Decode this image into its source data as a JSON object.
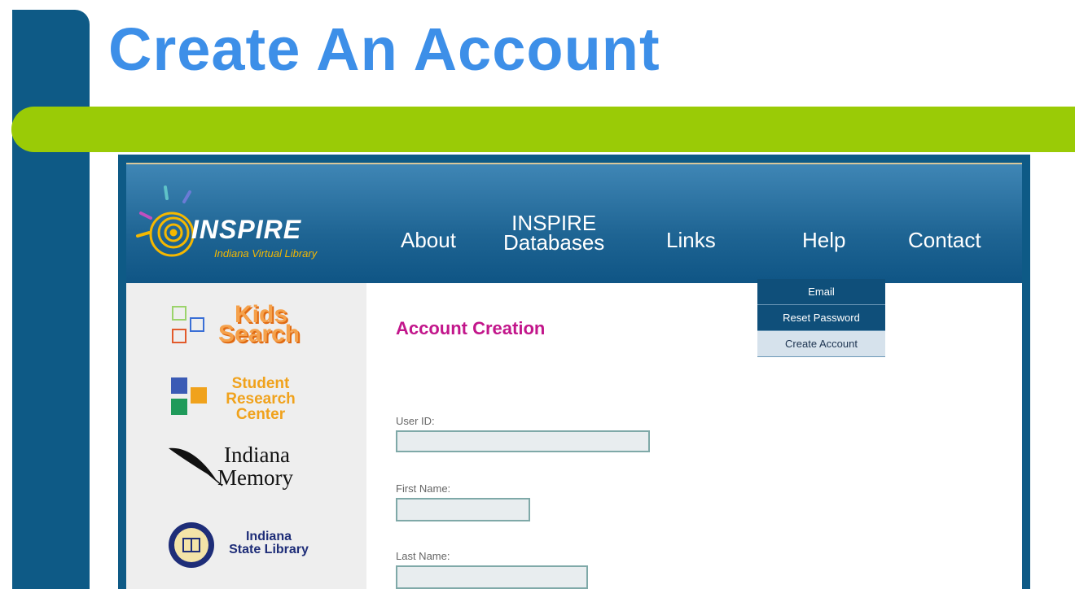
{
  "slide": {
    "title": "Create An Account"
  },
  "site": {
    "logo": {
      "name": "INSPIRE",
      "tagline": "Indiana Virtual Library"
    },
    "nav": {
      "about": "About",
      "databases_line1": "INSPIRE",
      "databases_line2": "Databases",
      "links": "Links",
      "help": "Help",
      "contact": "Contact"
    },
    "help_menu": {
      "items": [
        "Email",
        "Reset Password",
        "Create Account"
      ],
      "active": "Create Account"
    },
    "sidebar": {
      "kids_line1": "Kids",
      "kids_line2": "Search",
      "student_line1": "Student",
      "student_line2": "Research",
      "student_line3": "Center",
      "memory_line1": "Indiana",
      "memory_line2": "Memory",
      "isl_line1": "Indiana",
      "isl_line2": "State Library"
    },
    "form": {
      "title": "Account Creation",
      "user_id_label": "User ID:",
      "first_name_label": "First Name:",
      "last_name_label": "Last Name:",
      "user_id_value": "",
      "first_name_value": "",
      "last_name_value": ""
    }
  },
  "colors": {
    "slide_blue": "#0e5a86",
    "title_blue": "#3d8fe8",
    "accent_green": "#9acb06",
    "form_title_magenta": "#c2168b"
  }
}
